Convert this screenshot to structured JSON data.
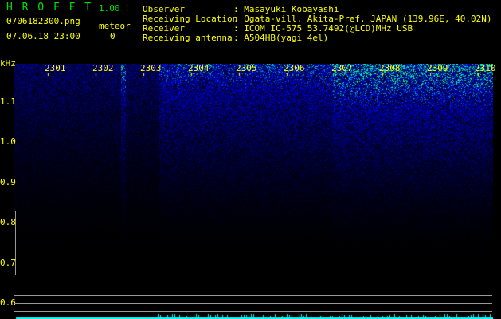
{
  "app": {
    "name": "H R O F F T",
    "version": "1.00"
  },
  "file": {
    "name": "0706182300.png",
    "datetime": "07.06.18 23:00"
  },
  "meteor": {
    "label": "meteor",
    "count": "0"
  },
  "info": [
    {
      "key": "Observer",
      "value": ": Masayuki Kobayashi"
    },
    {
      "key": "Receiving Location",
      "value": ": Ogata-vill. Akita-Pref. JAPAN (139.96E, 40.02N)"
    },
    {
      "key": "Receiver",
      "value": ": ICOM IC-575 53.7492(@LCD)MHz USB"
    },
    {
      "key": "Receiving antenna",
      "value": ": A504HB(yagi 4el)"
    }
  ],
  "axis": {
    "unit": "kHz",
    "minutes": [
      "2301",
      "2302",
      "2303",
      "2304",
      "2305",
      "2306",
      "2307",
      "2308",
      "2309",
      "2310"
    ],
    "freq_labels": [
      "1.1",
      "1.0",
      "0.9",
      "0.8",
      "0.7",
      "0.6"
    ]
  },
  "colors": {
    "text": "#ffff00",
    "title": "#00e000",
    "signal": "#00ffff"
  }
}
